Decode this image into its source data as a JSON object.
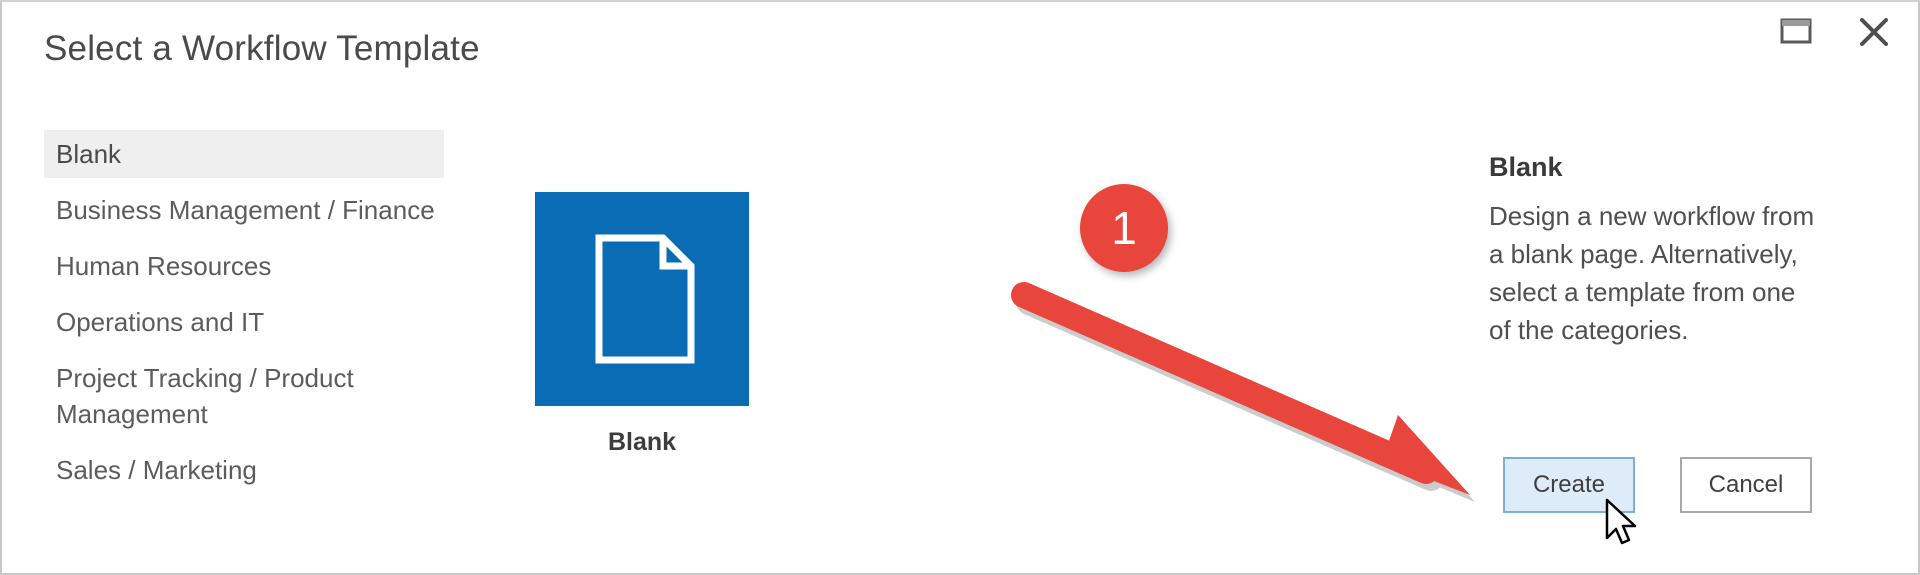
{
  "dialog": {
    "title": "Select a Workflow Template",
    "window_controls": [
      {
        "name": "restore",
        "glyph": "restore-icon"
      },
      {
        "name": "close",
        "glyph": "close-icon"
      }
    ]
  },
  "categories": {
    "selected": "Blank",
    "items": [
      {
        "label": "Blank",
        "selected": true
      },
      {
        "label": "Business Management / Finance",
        "selected": false
      },
      {
        "label": "Human Resources",
        "selected": false
      },
      {
        "label": "Operations and IT",
        "selected": false
      },
      {
        "label": "Project Tracking / Product Management",
        "selected": false
      },
      {
        "label": "Sales / Marketing",
        "selected": false
      }
    ]
  },
  "template": {
    "label": "Blank",
    "thumbnail_icon": "blank-document-icon",
    "tile_color": "#0a6cb4"
  },
  "details": {
    "title": "Blank",
    "description": "Design a new workflow from a blank page. Alternatively, select a template from one of the categories."
  },
  "buttons": {
    "create": "Create",
    "cancel": "Cancel"
  },
  "annotations": {
    "step_number": "1",
    "badge_color": "#e8453c",
    "arrow_color": "#e8453c",
    "arrow_points_to": "Create"
  }
}
